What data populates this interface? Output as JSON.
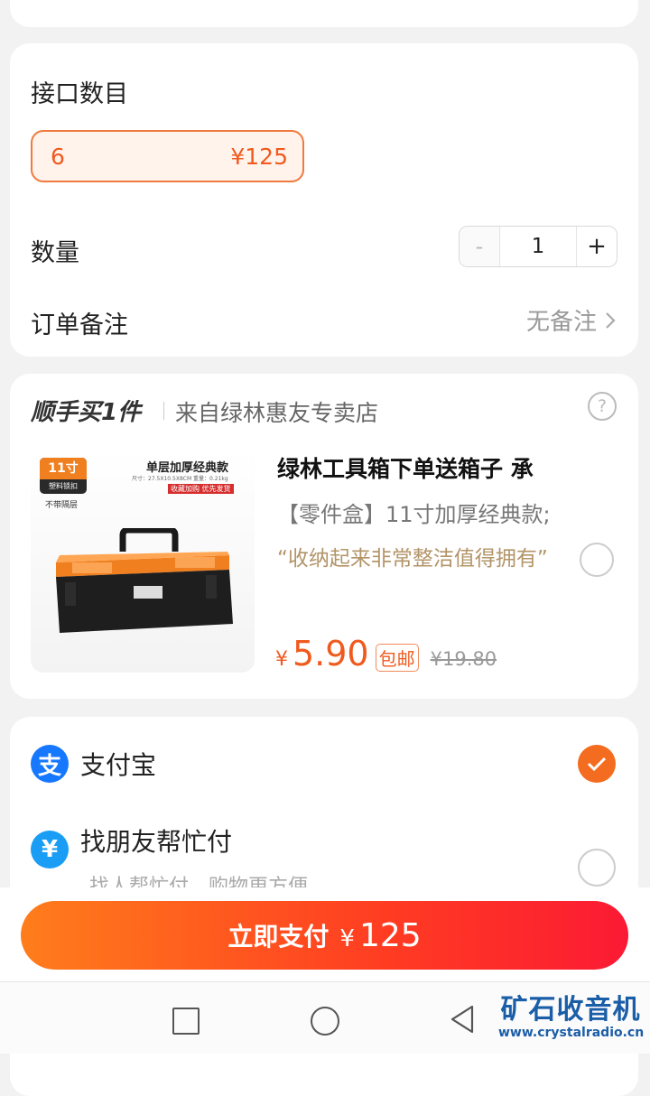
{
  "options": {
    "interface_label": "接口数目",
    "selected_spec_value": "6",
    "selected_spec_price": "¥125",
    "quantity_label": "数量",
    "quantity_minus": "-",
    "quantity_value": "1",
    "quantity_plus": "+",
    "remark_label": "订单备注",
    "remark_value": "无备注"
  },
  "addon": {
    "title": "顺手买1件",
    "store": "来自绿林惠友专卖店",
    "product": {
      "name": "绿林工具箱下单送箱子 承",
      "spec": "【零件盒】11寸加厚经典款;",
      "quote": "“收纳起来非常整洁值得拥有”",
      "price_symbol": "¥",
      "price": "5.90",
      "shipping_badge": "包邮",
      "original_price": "¥19.80",
      "image_tag_size": "11寸",
      "image_tag_sub": "塑料锁扣",
      "image_tag_note": "不带隔层",
      "image_heading": "单层加厚经典款",
      "image_dims": "尺寸：27.5X10.5X8CM  重量：0.21kg",
      "image_promo": "收藏加购 优先发货"
    }
  },
  "payment": {
    "alipay_icon_char": "支",
    "alipay_label": "支付宝",
    "friend_icon_char": "¥",
    "friend_label": "找朋友帮忙付",
    "friend_sub": "找人帮忙付，购物更方便",
    "accent_color": "#f36c1f"
  },
  "bottom": {
    "pay_button_label": "立即支付",
    "pay_symbol": "¥",
    "pay_amount": "125"
  },
  "watermark": {
    "title": "矿石收音机",
    "url": "www.crystalradio.cn"
  },
  "icons": {
    "nav_recent": "square-icon",
    "nav_home": "circle-icon",
    "nav_back": "triangle-back-icon",
    "help": "question-circle-icon",
    "chevron": "chevron-right-icon",
    "check": "check-icon"
  }
}
